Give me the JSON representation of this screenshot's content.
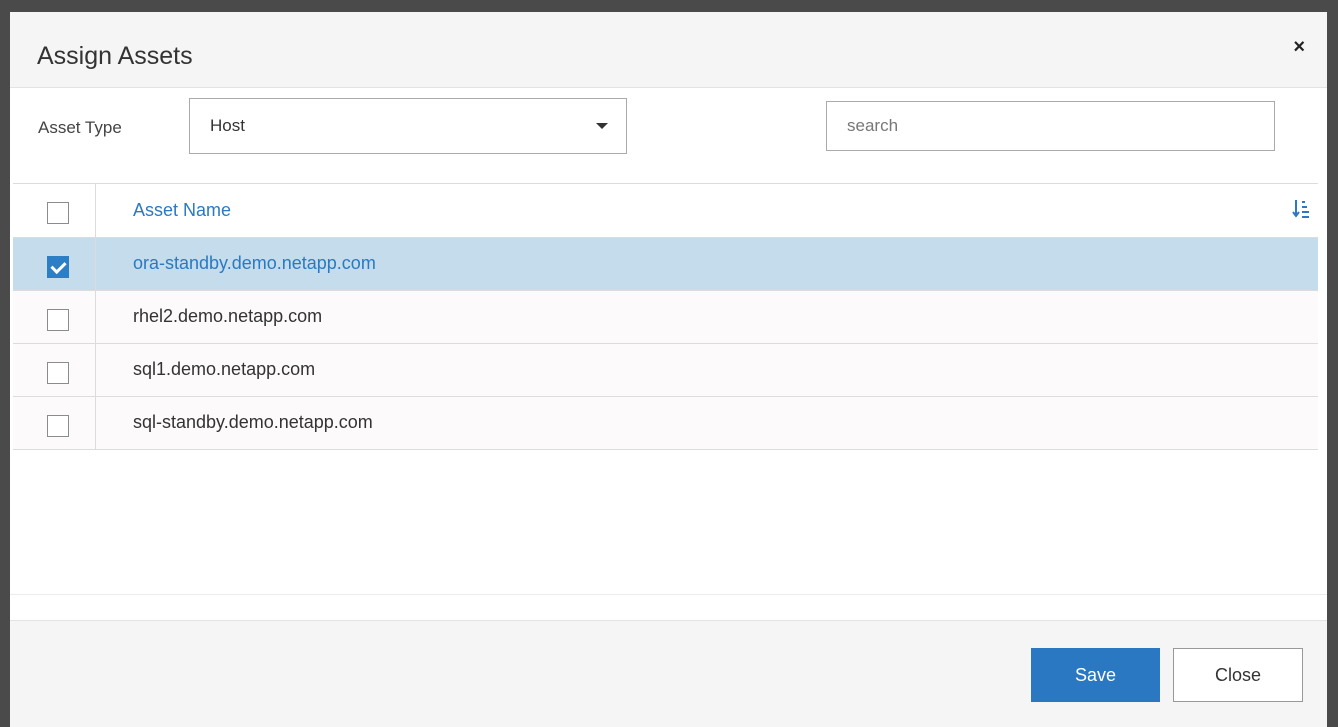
{
  "dialog": {
    "title": "Assign Assets",
    "close_glyph": "×"
  },
  "filter": {
    "asset_type_label": "Asset Type",
    "asset_type_value": "Host",
    "search_placeholder": "search",
    "search_value": ""
  },
  "table": {
    "column_header": "Asset Name",
    "rows": [
      {
        "name": "ora-standby.demo.netapp.com",
        "checked": true
      },
      {
        "name": "rhel2.demo.netapp.com",
        "checked": false
      },
      {
        "name": "sql1.demo.netapp.com",
        "checked": false
      },
      {
        "name": "sql-standby.demo.netapp.com",
        "checked": false
      }
    ]
  },
  "footer": {
    "save_label": "Save",
    "close_label": "Close"
  },
  "colors": {
    "accent": "#2a78c2",
    "selected_row": "#c4dcec"
  },
  "icons": {
    "sort": "sort-ascending-icon",
    "dropdown": "chevron-down-icon"
  }
}
